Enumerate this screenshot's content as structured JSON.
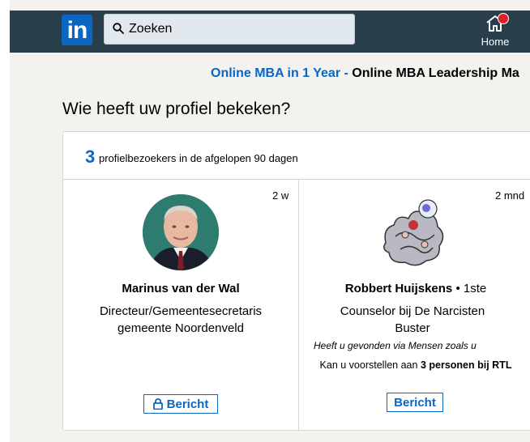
{
  "nav": {
    "logo_text": "in",
    "search_value": "Zoeken",
    "home_label": "Home"
  },
  "ad": {
    "link_text": "Online MBA in 1 Year -",
    "headline": "Online MBA Leadership Ma"
  },
  "section": {
    "title": "Wie heeft uw profiel bekeken?"
  },
  "summary": {
    "count": "3",
    "text": "profielbezoekers in de afgelopen 90 dagen"
  },
  "viewers": [
    {
      "time": "2 w",
      "name": "Marinus van der Wal",
      "headline": "Directeur/Gemeentesecretaris gemeente Noordenveld",
      "button_label": "Bericht"
    },
    {
      "time": "2 mnd",
      "name": "Robbert Huijskens",
      "degree": "• 1ste",
      "headline": "Counselor bij De Narcisten Buster",
      "found_via": "Heeft u gevonden via Mensen zoals u",
      "intro_prefix": "Kan u voorstellen aan",
      "intro_bold": "3 personen bij RTL",
      "button_label": "Bericht"
    }
  ],
  "colors": {
    "nav_bg": "#283e4a",
    "brand_blue": "#0a66c2",
    "notification_red": "#e31e24"
  },
  "icons": [
    "search-icon",
    "home-icon",
    "lock-icon"
  ]
}
